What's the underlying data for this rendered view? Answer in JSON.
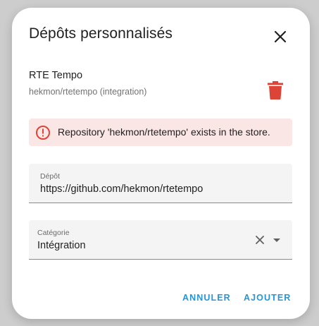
{
  "dialog": {
    "title": "Dépôts personnalisés",
    "close_icon": "close-icon"
  },
  "repository_entry": {
    "name": "RTE Tempo",
    "subtitle": "hekmon/rtetempo (integration)",
    "delete_icon": "trash-icon"
  },
  "alert": {
    "icon": "alert-circle-icon",
    "message": "Repository 'hekmon/rtetempo' exists in the store."
  },
  "repository_field": {
    "label": "Dépôt",
    "value": "https://github.com/hekmon/rtetempo"
  },
  "category_field": {
    "label": "Catégorie",
    "value": "Intégration",
    "clear_icon": "clear-icon",
    "dropdown_icon": "chevron-down-icon"
  },
  "actions": {
    "cancel_label": "ANNULER",
    "add_label": "AJOUTER"
  },
  "colors": {
    "primary": "#2596d6",
    "error": "#db4437",
    "alert_background": "#fbe6e6"
  }
}
